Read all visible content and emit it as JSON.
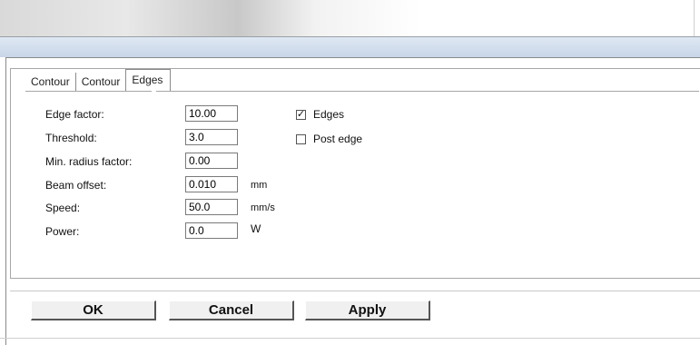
{
  "tabs": [
    {
      "label": "Contour",
      "active": false
    },
    {
      "label": "Contour",
      "active": false
    },
    {
      "label": "Edges",
      "active": true
    }
  ],
  "fields": [
    {
      "label": "Edge factor:",
      "value": "10.00",
      "unit": ""
    },
    {
      "label": "Threshold:",
      "value": "3.0",
      "unit": ""
    },
    {
      "label": "Min. radius factor:",
      "value": "0.00",
      "unit": ""
    },
    {
      "label": "Beam offset:",
      "value": "0.010",
      "unit": "mm"
    },
    {
      "label": "Speed:",
      "value": "50.0",
      "unit": "mm/s"
    },
    {
      "label": "Power:",
      "value": "0.0",
      "unit": "W"
    }
  ],
  "checkboxes": [
    {
      "label": "Edges",
      "checked": true,
      "mark": "✓"
    },
    {
      "label": "Post edge",
      "checked": false,
      "mark": ""
    }
  ],
  "buttons": {
    "ok": "OK",
    "cancel": "Cancel",
    "apply": "Apply"
  }
}
